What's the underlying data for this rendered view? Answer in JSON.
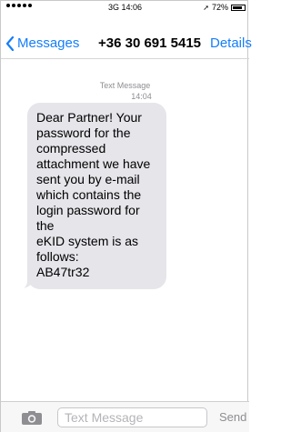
{
  "status_bar": {
    "network": "3G",
    "time": "14:06",
    "battery": "72%",
    "battery_level": 0.72
  },
  "nav": {
    "back_label": "Messages",
    "title": "+36 30 691 5415",
    "details_label": "Details"
  },
  "thread": {
    "label": "Text Message",
    "time": "14:04"
  },
  "message": {
    "text": "Dear Partner!  Your\npassword for the\ncompressed\nattachment we have\nsent you by e-mail\nwhich contains the\nlogin password for the\neKID system is as\nfollows:\nAB47tr32"
  },
  "composer": {
    "placeholder": "Text Message",
    "send_label": "Send"
  },
  "icons": {
    "back": "chevron-left-icon",
    "camera": "camera-icon",
    "location": "location-arrow-icon",
    "battery": "battery-icon",
    "signal": "signal-dots-icon"
  },
  "colors": {
    "accent": "#147efb",
    "bubble": "#e5e5ea",
    "meta": "#8e8e93"
  }
}
